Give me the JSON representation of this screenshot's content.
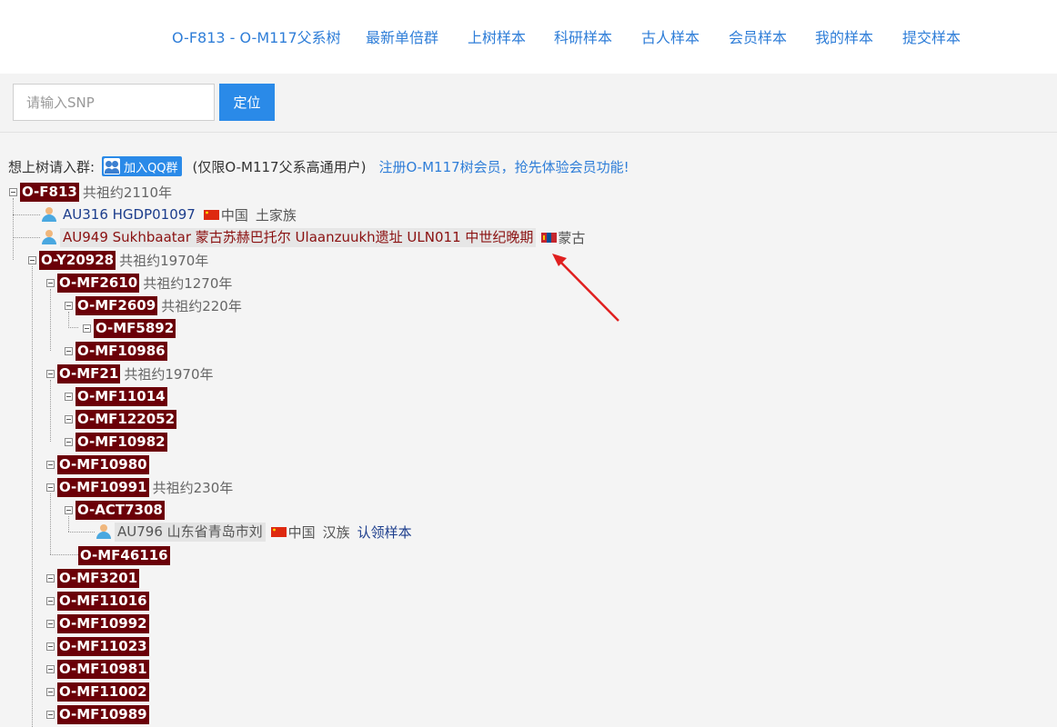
{
  "nav": {
    "links": [
      "O-F813 - O-M117父系树",
      "最新单倍群",
      "上树样本",
      "科研样本",
      "古人样本",
      "会员样本",
      "我的样本",
      "提交样本"
    ]
  },
  "search": {
    "placeholder": "请输入SNP",
    "value": "",
    "button_label": "定位"
  },
  "join": {
    "prefix": "想上树请入群:",
    "qq_label": "加入QQ群",
    "note": "(仅限O-M117父系高通用户)",
    "member_link": "注册O-M117树会员，抢先体验会员功能!"
  },
  "tree": {
    "root": {
      "hap": "O-F813",
      "age": "共祖约2110年"
    },
    "samples": [
      {
        "id": "AU316 HGDP01097",
        "country": "中国",
        "ethnic": "土家族"
      },
      {
        "id": "AU949 Sukhbaatar 蒙古苏赫巴托尔 Ulaanzuukh遗址 ULN011 中世纪晚期",
        "country": "蒙古"
      },
      {
        "id": "AU796 山东省青岛市刘",
        "country": "中国",
        "ethnic": "汉族",
        "action": "认领样本"
      }
    ],
    "nodes": [
      {
        "hap": "O-Y20928",
        "age": "共祖约1970年"
      },
      {
        "hap": "O-MF2610",
        "age": "共祖约1270年"
      },
      {
        "hap": "O-MF2609",
        "age": "共祖约220年"
      },
      {
        "hap": "O-MF5892"
      },
      {
        "hap": "O-MF10986"
      },
      {
        "hap": "O-MF21",
        "age": "共祖约1970年"
      },
      {
        "hap": "O-MF11014"
      },
      {
        "hap": "O-MF122052"
      },
      {
        "hap": "O-MF10982"
      },
      {
        "hap": "O-MF10980"
      },
      {
        "hap": "O-MF10991",
        "age": "共祖约230年"
      },
      {
        "hap": "O-ACT7308"
      },
      {
        "hap": "O-MF46116"
      },
      {
        "hap": "O-MF3201"
      },
      {
        "hap": "O-MF11016"
      },
      {
        "hap": "O-MF10992"
      },
      {
        "hap": "O-MF11023"
      },
      {
        "hap": "O-MF10981"
      },
      {
        "hap": "O-MF11002"
      },
      {
        "hap": "O-MF10989"
      }
    ]
  },
  "colors": {
    "haplogroup_bg": "#6b0008",
    "link_blue": "#2f7ed8",
    "button_blue": "#2a8ae8",
    "annotation_arrow": "#e02020"
  }
}
